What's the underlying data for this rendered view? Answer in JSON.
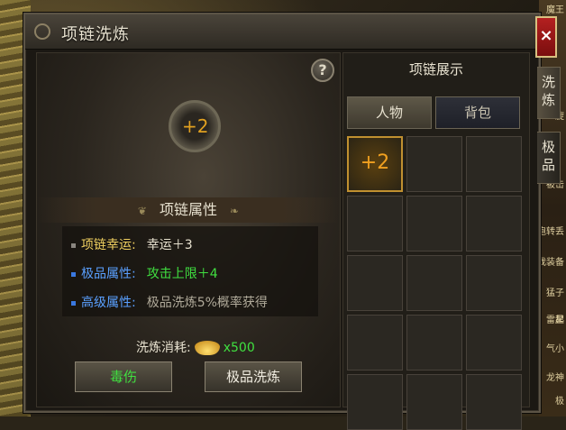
{
  "window": {
    "title": "项链洗炼",
    "close_label": "×"
  },
  "side_tabs": [
    {
      "label": "洗炼"
    },
    {
      "label": "极品"
    }
  ],
  "right_edge_scraps": [
    "魔王",
    "旋",
    "起",
    "跑转丢",
    "玉我装备",
    "猛子",
    "雷星",
    "气小",
    "龙神",
    "极",
    "被击"
  ],
  "left_panel": {
    "help_label": "?",
    "item_icon": "necklace-icon",
    "item_level": "+2",
    "section_title": "项链属性",
    "attributes": [
      {
        "label": "项链幸运:",
        "value": "幸运＋3",
        "label_color": "#f0d060",
        "value_color": "#e8e2d0"
      },
      {
        "label": "极品属性:",
        "value": "攻击上限＋4",
        "label_color": "#5aa0ff",
        "value_color": "#40e040"
      },
      {
        "label": "高级属性:",
        "value": "极品洗炼5%概率获得",
        "label_color": "#5aa0ff",
        "value_color": "#b0aa9a"
      }
    ],
    "cost_label": "洗炼消耗:",
    "cost_icon": "gold-ingot-icon",
    "cost_amount": "x500",
    "buttons": [
      {
        "label": "毒伤"
      },
      {
        "label": "极品洗炼"
      }
    ]
  },
  "right_panel": {
    "title": "项链展示",
    "tabs": [
      {
        "label": "人物",
        "active": true
      },
      {
        "label": "背包",
        "active": false
      }
    ],
    "slots": [
      {
        "filled": true,
        "text": "+2"
      },
      {
        "filled": false
      },
      {
        "filled": false
      },
      {
        "filled": false
      },
      {
        "filled": false
      },
      {
        "filled": false
      },
      {
        "filled": false
      },
      {
        "filled": false
      },
      {
        "filled": false
      },
      {
        "filled": false
      },
      {
        "filled": false
      },
      {
        "filled": false
      },
      {
        "filled": false
      },
      {
        "filled": false
      },
      {
        "filled": false
      }
    ]
  }
}
